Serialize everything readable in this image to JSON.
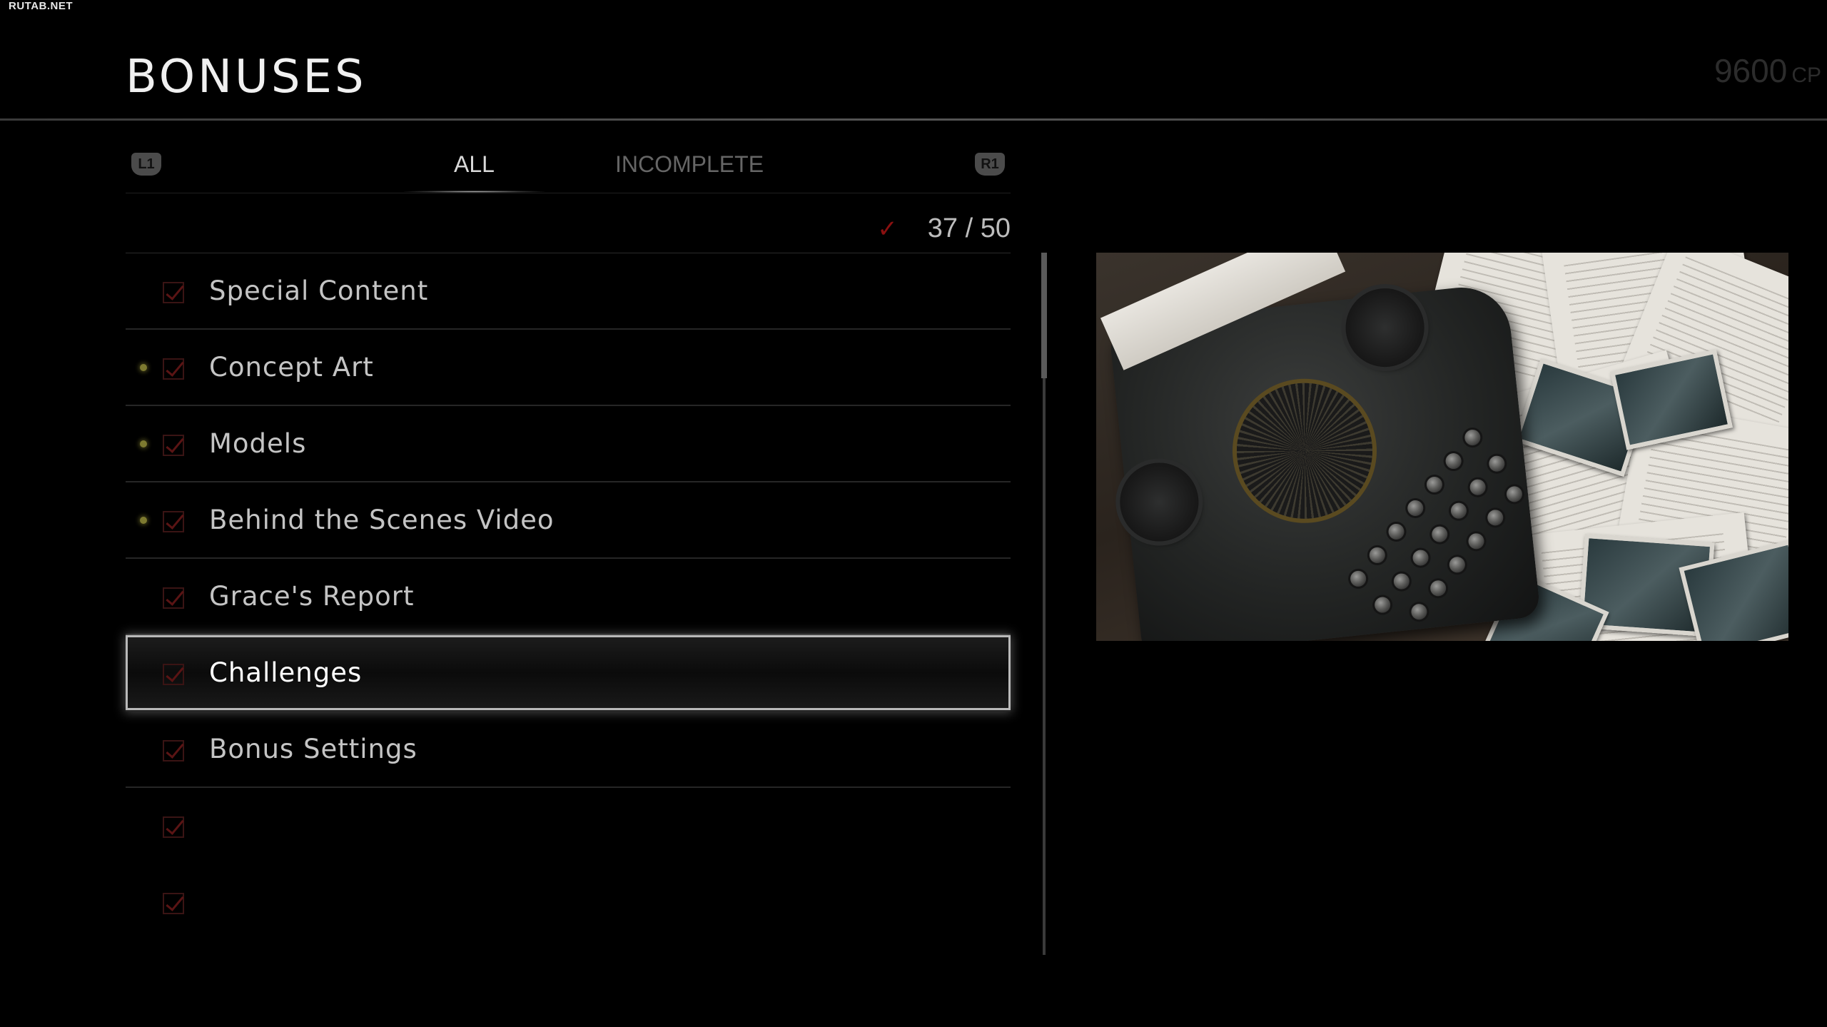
{
  "watermark": "RUTAB.NET",
  "header": {
    "title": "BONUSES",
    "cp_value": "9600",
    "cp_unit": "CP"
  },
  "tabs": {
    "left_bumper": "L1",
    "right_bumper": "R1",
    "items": [
      {
        "label": "ALL",
        "active": true
      },
      {
        "label": "INCOMPLETE",
        "active": false
      }
    ]
  },
  "progress": {
    "completed": "37 / 50"
  },
  "list": {
    "items": [
      {
        "label": "Special Content",
        "new": false,
        "selected": false
      },
      {
        "label": "Concept Art",
        "new": true,
        "selected": false
      },
      {
        "label": "Models",
        "new": true,
        "selected": false
      },
      {
        "label": "Behind the Scenes Video",
        "new": true,
        "selected": false
      },
      {
        "label": "Grace's Report",
        "new": false,
        "selected": false
      },
      {
        "label": "Challenges",
        "new": false,
        "selected": true
      },
      {
        "label": "Bonus Settings",
        "new": false,
        "selected": false
      },
      {
        "label": "",
        "new": false,
        "selected": false
      },
      {
        "label": "",
        "new": false,
        "selected": false
      }
    ]
  },
  "colors": {
    "background": "#000000",
    "check_red": "#8a1010",
    "new_dot": "#7d7a30",
    "selection_outline": "#b9b9b9"
  },
  "preview": {
    "image": "typewriter-on-desk-with-papers-and-photos"
  }
}
